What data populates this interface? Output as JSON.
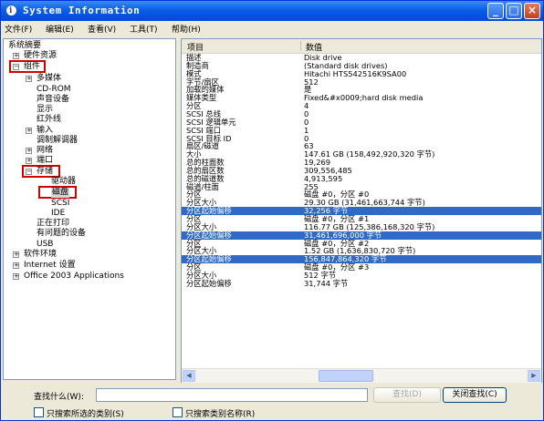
{
  "window": {
    "title": "System Information",
    "icon_letter": "i"
  },
  "title_buttons": {
    "minimize": "_",
    "maximize": "□",
    "close": "×"
  },
  "menu": [
    "文件(F)",
    "编辑(E)",
    "查看(V)",
    "工具(T)",
    "帮助(H)"
  ],
  "tree": {
    "root": "系统摘要",
    "hardware_resources": "硬件资源",
    "components": "组件",
    "multimedia": "多媒体",
    "cdrom": "CD-ROM",
    "sound": "声音设备",
    "display": "显示",
    "infrared": "红外线",
    "input": "输入",
    "modem": "调制解调器",
    "network": "网络",
    "ports": "端口",
    "storage": "存储",
    "drives": "驱动器",
    "disks": "磁盘",
    "scsi": "SCSI",
    "ide": "IDE",
    "printing": "正在打印",
    "problem_devices": "有问题的设备",
    "usb": "USB",
    "software_env": "软件环境",
    "internet_settings": "Internet 设置",
    "office": "Office 2003 Applications"
  },
  "list": {
    "columns": [
      "项目",
      "数值"
    ],
    "rows": [
      {
        "k": "描述",
        "v": "Disk drive"
      },
      {
        "k": "制造商",
        "v": "(Standard disk drives)"
      },
      {
        "k": "模式",
        "v": "Hitachi HTS542516K9SA00"
      },
      {
        "k": "字节/扇区",
        "v": "512"
      },
      {
        "k": "加载的媒体",
        "v": "是"
      },
      {
        "k": "媒体类型",
        "v": "Fixed&#x0009;hard disk media"
      },
      {
        "k": "分区",
        "v": "4"
      },
      {
        "k": "SCSI 总线",
        "v": "0"
      },
      {
        "k": "SCSI 逻辑单元",
        "v": "0"
      },
      {
        "k": "SCSI 端口",
        "v": "1"
      },
      {
        "k": "SCSI 目标 ID",
        "v": "0"
      },
      {
        "k": "扇区/磁道",
        "v": "63"
      },
      {
        "k": "大小",
        "v": "147.61 GB (158,492,920,320 字节)"
      },
      {
        "k": "总的柱面数",
        "v": "19,269"
      },
      {
        "k": "总的扇区数",
        "v": "309,556,485"
      },
      {
        "k": "总的磁道数",
        "v": "4,913,595"
      },
      {
        "k": "磁道/柱面",
        "v": "255"
      },
      {
        "k": "分区",
        "v": "磁盘 #0，分区 #0"
      },
      {
        "k": "分区大小",
        "v": "29.30 GB (31,461,663,744 字节)"
      },
      {
        "k": "分区起始偏移",
        "v": "32,256 字节"
      },
      {
        "k": "分区",
        "v": "磁盘 #0，分区 #1"
      },
      {
        "k": "分区大小",
        "v": "116.77 GB (125,386,168,320 字节)"
      },
      {
        "k": "分区起始偏移",
        "v": "31,461,696,000 字节"
      },
      {
        "k": "分区",
        "v": "磁盘 #0，分区 #2"
      },
      {
        "k": "分区大小",
        "v": "1.52 GB (1,636,830,720 字节)"
      },
      {
        "k": "分区起始偏移",
        "v": "156,847,864,320 字节"
      },
      {
        "k": "分区",
        "v": "磁盘 #0，分区 #3"
      },
      {
        "k": "分区大小",
        "v": "512 字节"
      },
      {
        "k": "分区起始偏移",
        "v": "31,744 字节"
      }
    ]
  },
  "search": {
    "label": "查找什么(W):",
    "value": "",
    "find_button": "查找(D)",
    "close_find_button": "关闭查找(C)",
    "only_selected": "只搜索所选的类别(S)",
    "only_names": "只搜索类别名称(R)"
  },
  "colors": {
    "titlebar": "#0a5ee8",
    "selection": "#316ac5",
    "highlight_box": "#d00000"
  }
}
